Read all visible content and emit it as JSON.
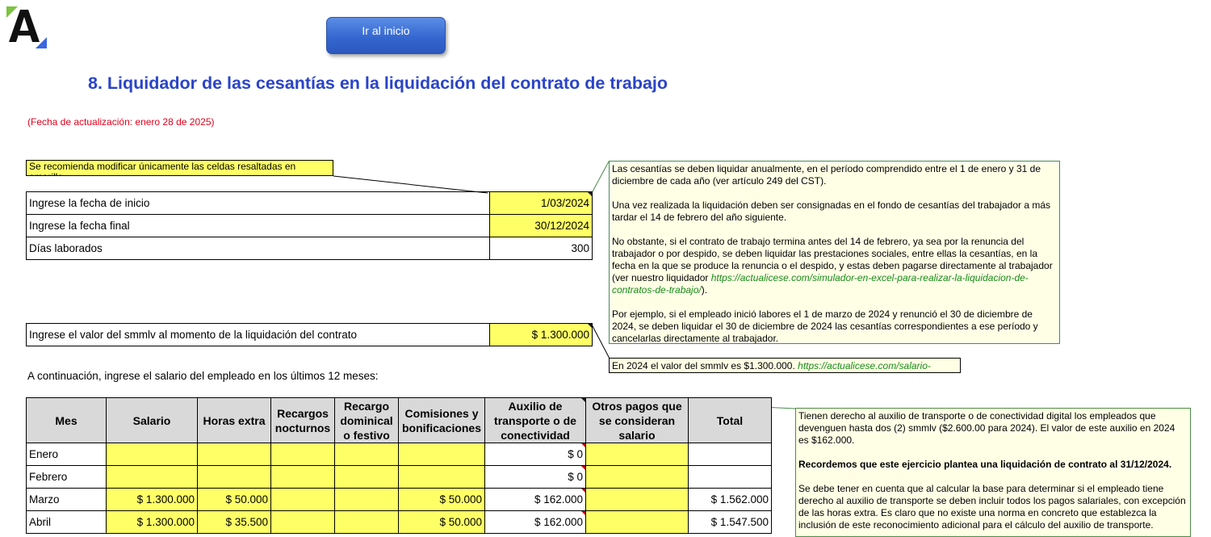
{
  "toolbar": {
    "home_button_label": "Ir al inicio"
  },
  "page": {
    "title": "8. Liquidador de las cesantías en la liquidación del contrato de trabajo",
    "update_note": "(Fecha de actualización: enero 28 de 2025)",
    "recommend_note": "Se recomienda modificar únicamente las celdas resaltadas en amarillo"
  },
  "dates": {
    "rows": [
      {
        "label": "Ingrese la fecha de inicio",
        "value": "1/03/2024"
      },
      {
        "label": "Ingrese la fecha final",
        "value": "30/12/2024"
      },
      {
        "label": "Días laborados",
        "value": "300"
      }
    ]
  },
  "smmlv": {
    "label": "Ingrese el valor del smmlv al momento de la liquidación del contrato",
    "value": "$ 1.300.000"
  },
  "comments": {
    "cesantias": {
      "p1": "Las cesantías se deben liquidar anualmente, en el período comprendido entre el 1 de enero y 31 de diciembre de cada año (ver artículo 249 del CST).",
      "p2": "Una vez realizada la liquidación deben ser consignadas en el fondo de cesantías del trabajador a más tardar el 14 de febrero del año siguiente.",
      "p3": "No obstante, si el contrato de trabajo termina antes del 14 de febrero, ya sea por la renuncia del trabajador o por despido, se deben liquidar las prestaciones sociales, entre ellas la cesantías, en la fecha en la que se produce la renuncia o el despido, y estas deben pagarse directamente al trabajador (ver nuestro liquidador ",
      "p3_link": "https://actualicese.com/simulador-en-excel-para-realizar-la-liquidacion-de-contratos-de-trabajo/",
      "p3_end": ").",
      "p4": "Por ejemplo, si el empleado inició labores el 1 de marzo de 2024 y renunció el 30 de diciembre de 2024, se deben liquidar el 30 de diciembre de 2024 las cesantías correspondientes a ese período y cancelarlas directamente al trabajador."
    },
    "smmlv": {
      "text": "En 2024 el valor del smmlv es $1.300.000. ",
      "link": "https://actualicese.com/salario-"
    },
    "auxilio": {
      "p1": "Tienen derecho al auxilio de transporte o de conectividad digital los empleados que devenguen hasta dos (2) smmlv ($2.600.00 para 2024). El valor de este auxilio en 2024 es $162.000.",
      "p2": "Recordemos que este ejercicio plantea una liquidación de contrato al 31/12/2024.",
      "p3": "Se debe tener en cuenta que al calcular la base para determinar si el empleado tiene derecho al auxilio de transporte se deben incluir todos los pagos salariales, con excepción de las horas extra. Es claro que no existe una norma en concreto que establezca la inclusión de este reconocimiento adicional para el cálculo del auxilio de transporte."
    }
  },
  "salary_table": {
    "instruction": "A continuación, ingrese el salario del empleado en los últimos 12 meses:",
    "headers": [
      "Mes",
      "Salario",
      "Horas extra",
      "Recargos nocturnos",
      "Recargo dominical o festivo",
      "Comisiones y bonificaciones",
      "Auxilio de transporte o de conectividad",
      "Otros pagos que se consideran salario",
      "Total"
    ],
    "rows": [
      {
        "mes": "Enero",
        "salario": "",
        "horas": "",
        "nocturnos": "",
        "dominical": "",
        "comisiones": "",
        "auxilio": "$ 0",
        "otros": "",
        "total": ""
      },
      {
        "mes": "Febrero",
        "salario": "",
        "horas": "",
        "nocturnos": "",
        "dominical": "",
        "comisiones": "",
        "auxilio": "$ 0",
        "otros": "",
        "total": ""
      },
      {
        "mes": "Marzo",
        "salario": "$ 1.300.000",
        "horas": "$ 50.000",
        "nocturnos": "",
        "dominical": "",
        "comisiones": "$ 50.000",
        "auxilio": "$ 162.000",
        "otros": "",
        "total": "$ 1.562.000"
      },
      {
        "mes": "Abril",
        "salario": "$ 1.300.000",
        "horas": "$ 35.500",
        "nocturnos": "",
        "dominical": "",
        "comisiones": "$ 50.000",
        "auxilio": "$ 162.000",
        "otros": "",
        "total": "$ 1.547.500"
      }
    ]
  },
  "colors": {
    "title": "#2a44c9",
    "highlight": "#ffff66",
    "update_note": "#e0001c",
    "link": "#1a8a1a"
  },
  "icons": {
    "logo": "actualicese-logo"
  }
}
